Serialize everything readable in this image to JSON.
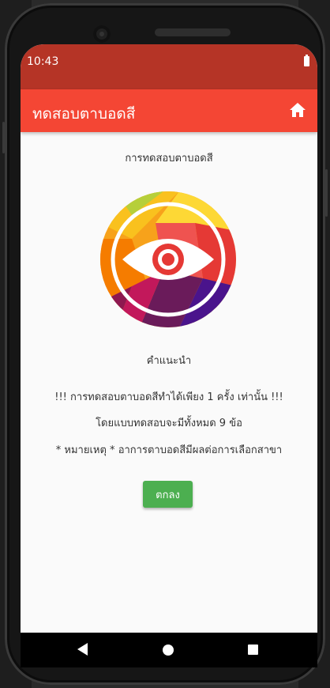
{
  "status_bar": {
    "time": "10:43",
    "battery_icon": "battery-icon"
  },
  "toolbar": {
    "title": "ทดสอบตาบอดสี",
    "home_icon": "home-icon"
  },
  "main": {
    "heading": "การทดสอบตาบอดสี",
    "logo_icon": "eye-icon",
    "instructions_title": "คำแนะนำ",
    "lines": [
      "!!! การทดสอบตาบอดสีทำได้เพียง 1 ครั้ง เท่านั้น !!!",
      "โดยแบบทดสอบจะมีทั้งหมด 9 ข้อ",
      "* หมายเหตุ * อาการตาบอดสีมีผลต่อการเลือกสาขา"
    ],
    "ok_label": "ตกลง"
  },
  "nav": {
    "back_icon": "back-icon",
    "home_icon": "home-circle-icon",
    "recent_icon": "recent-apps-icon"
  },
  "colors": {
    "status_bar": "#b53426",
    "toolbar": "#f44634",
    "button": "#4caf50"
  }
}
